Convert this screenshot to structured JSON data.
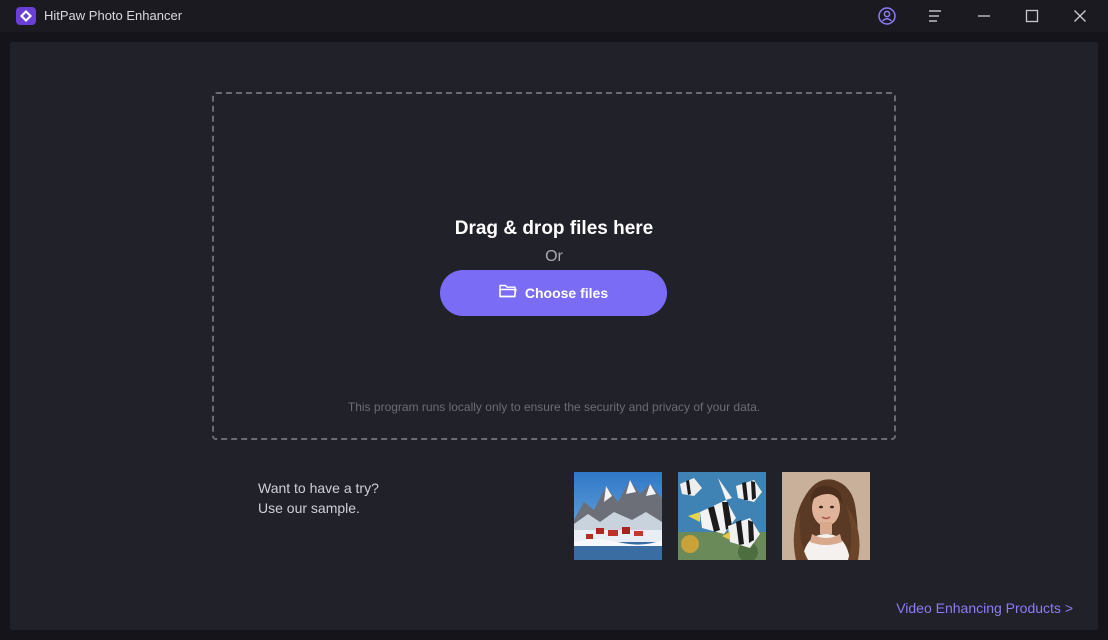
{
  "window": {
    "title": "HitPaw Photo Enhancer",
    "icons": [
      "app-logo-icon",
      "user-icon",
      "menu-icon",
      "minimize-icon",
      "maximize-icon",
      "close-icon"
    ],
    "colors": {
      "titlebar": "#1a1a20",
      "background": "#212129",
      "accent": "#7b6cf6"
    }
  },
  "dropzone": {
    "heading": "Drag & drop files here",
    "or": "Or",
    "choose_label": "Choose files",
    "choose_icon": "folder-icon",
    "privacy": "This program runs locally only to ensure the security and privacy of your data."
  },
  "samples": {
    "line1": "Want to have a try?",
    "line2": "Use our sample.",
    "items": [
      "sample-landscape-image",
      "sample-fish-image",
      "sample-portrait-image"
    ]
  },
  "footer": {
    "video_link": "Video Enhancing Products >"
  }
}
